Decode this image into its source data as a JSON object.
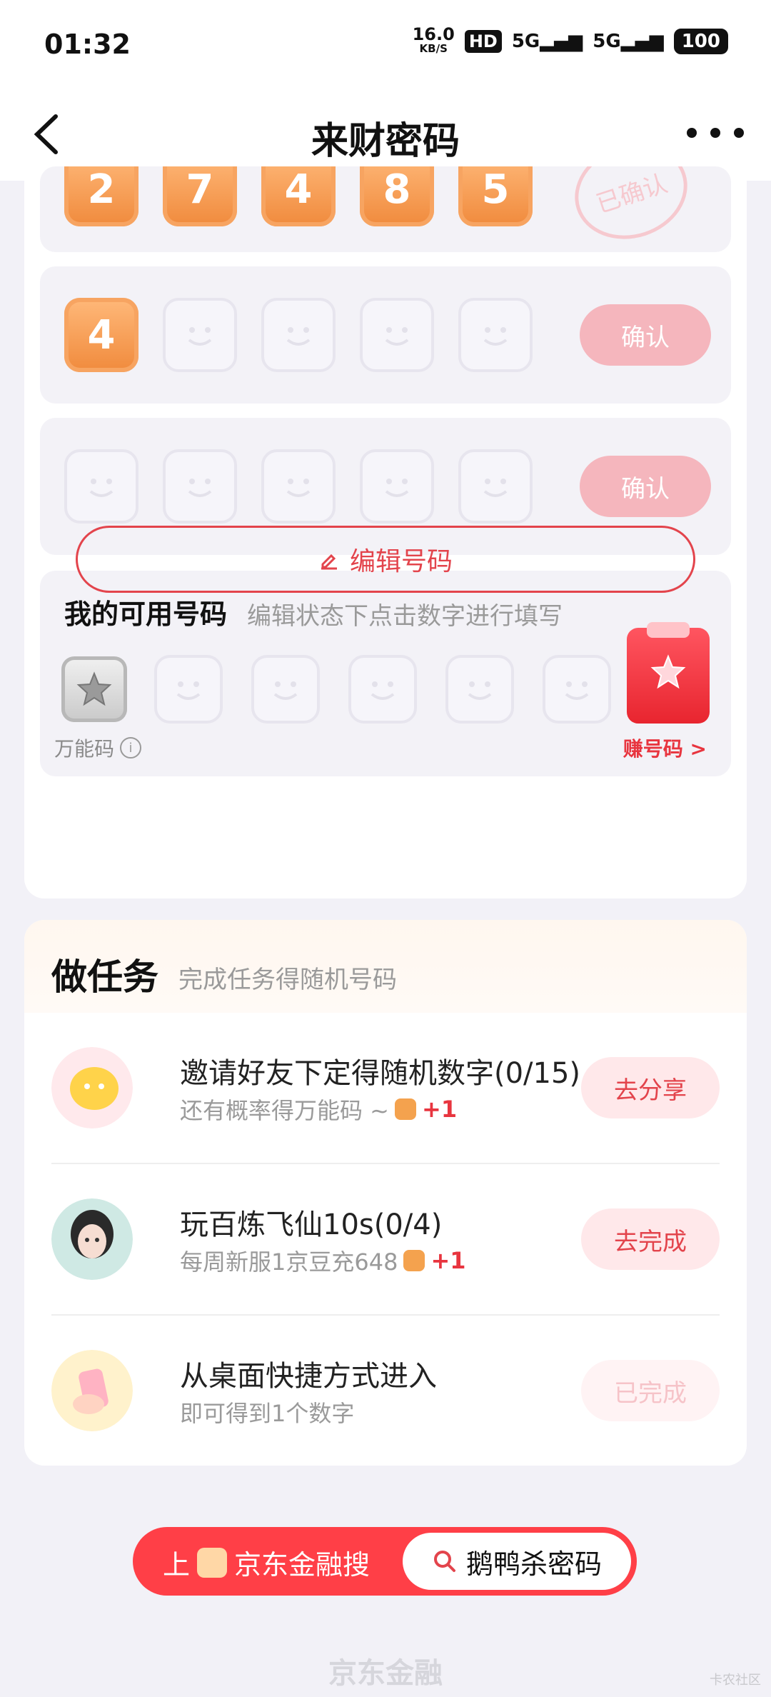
{
  "status_bar": {
    "time": "01:32",
    "net_speed": "16.0",
    "net_unit": "KB/S",
    "hd": "HD",
    "signal_1": "5G",
    "signal_2": "5G",
    "battery": "100"
  },
  "nav": {
    "title": "来财密码"
  },
  "rows": [
    {
      "digits": [
        "2",
        "7",
        "4",
        "8",
        "5"
      ],
      "stamp": "已确认"
    },
    {
      "digits": [
        "4"
      ],
      "confirm": "确认"
    },
    {
      "digits": [],
      "confirm": "确认"
    }
  ],
  "available": {
    "title": "我的可用号码",
    "hint": "编辑状态下点击数字进行填写",
    "wild_label": "万能码",
    "info_icon": "i",
    "earn_label": "赚号码 >"
  },
  "edit_button": "编辑号码",
  "tasks": {
    "title": "做任务",
    "subtitle": "完成任务得随机号码",
    "items": [
      {
        "name": "邀请好友下定得随机数字(0/15)",
        "desc": "还有概率得万能码 ~",
        "reward": "+1",
        "button": "去分享",
        "avatar": "chat-bubble-icon"
      },
      {
        "name": "玩百炼飞仙10s(0/4)",
        "desc": "每周新服1京豆充648",
        "reward": "+1",
        "button": "去完成",
        "avatar": "game-character-avatar"
      },
      {
        "name": "从桌面快捷方式进入",
        "desc": "即可得到1个数字",
        "reward": "",
        "button": "已完成",
        "avatar": "phone-hand-icon"
      }
    ]
  },
  "banner": {
    "left_text": "上",
    "brand": "京东金融搜",
    "search_text": "鹅鸭杀密码"
  },
  "footer": {
    "logo_text": "京东金融",
    "watermark": "卡农社区"
  },
  "colors": {
    "accent": "#e3444c",
    "tile_orange": "#f08a3c",
    "confirm_pink": "#f5b6bd"
  }
}
